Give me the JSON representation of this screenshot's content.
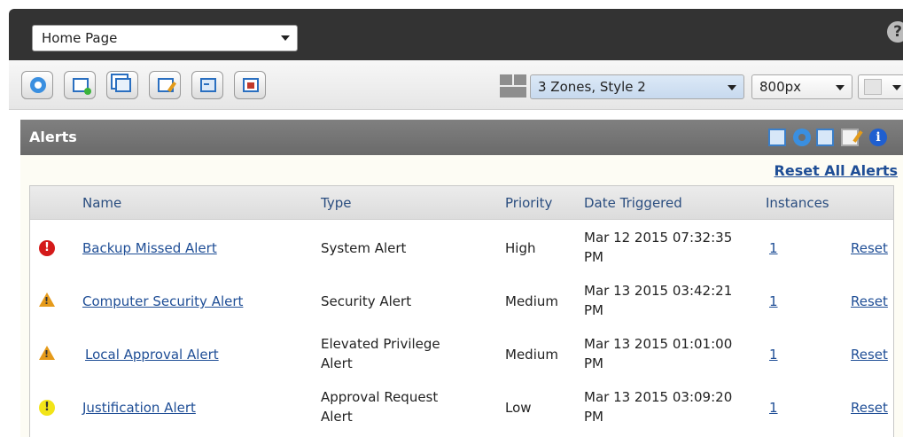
{
  "topbar": {
    "page_select_value": "Home Page",
    "help_glyph": "?"
  },
  "toolbar": {
    "buttons": [
      {
        "name": "refresh",
        "icon": "refresh-icon"
      },
      {
        "name": "add-window",
        "icon": "add-window-icon"
      },
      {
        "name": "cascade",
        "icon": "cascade-windows-icon"
      },
      {
        "name": "edit-page",
        "icon": "edit-page-icon"
      },
      {
        "name": "console",
        "icon": "console-icon"
      },
      {
        "name": "home",
        "icon": "home-icon"
      }
    ],
    "layout_value": "3 Zones, Style 2",
    "width_value": "800px"
  },
  "alerts_panel": {
    "title": "Alerts",
    "reset_all_label": "Reset All Alerts",
    "info_glyph": "i",
    "columns": {
      "name": "Name",
      "type": "Type",
      "priority": "Priority",
      "date": "Date Triggered",
      "instances": "Instances"
    },
    "rows": [
      {
        "severity": "high",
        "severity_glyph": "!",
        "name": "Backup Missed Alert",
        "type_line1": "System Alert",
        "type_line2": "",
        "priority": "High",
        "date_line1": "Mar 12 2015 07:32:35",
        "date_line2": "PM",
        "instances": "1",
        "reset": "Reset"
      },
      {
        "severity": "medium",
        "severity_glyph": "!",
        "name": "Computer Security Alert",
        "type_line1": "Security Alert",
        "type_line2": "",
        "priority": "Medium",
        "date_line1": "Mar 13 2015 03:42:21",
        "date_line2": "PM",
        "instances": "1",
        "reset": "Reset"
      },
      {
        "severity": "medium",
        "severity_glyph": "!",
        "name": "Local Approval Alert",
        "type_line1": "Elevated Privilege",
        "type_line2": "Alert",
        "priority": "Medium",
        "date_line1": "Mar 13 2015 01:01:00",
        "date_line2": "PM",
        "instances": "1",
        "reset": "Reset"
      },
      {
        "severity": "low",
        "severity_glyph": "!",
        "name": "Justification Alert",
        "type_line1": "Approval Request",
        "type_line2": "Alert",
        "priority": "Low",
        "date_line1": "Mar 13 2015 03:09:20",
        "date_line2": "PM",
        "instances": "1",
        "reset": "Reset"
      }
    ]
  },
  "colors": {
    "topbar_bg": "#333333",
    "panel_header_bg": "#707070",
    "link": "#1f4e96",
    "severity_high": "#d41a1a",
    "severity_medium": "#e59a1a",
    "severity_low": "#f2e418"
  }
}
